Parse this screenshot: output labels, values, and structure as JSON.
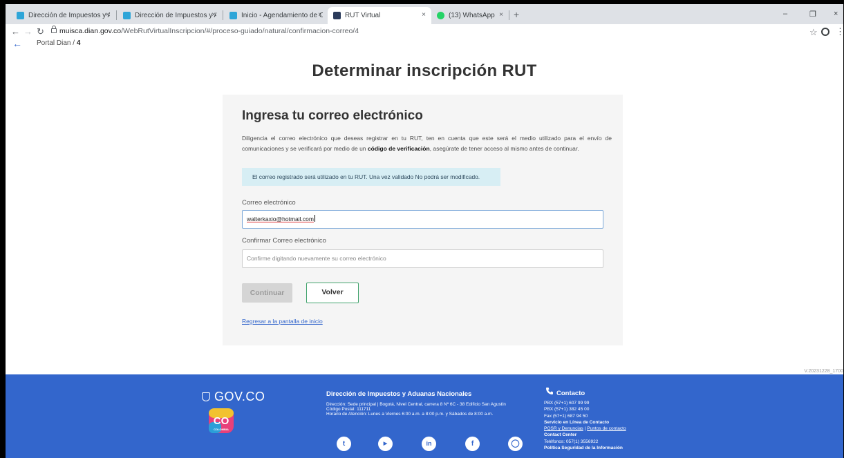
{
  "browser": {
    "tabs": [
      {
        "title": "Dirección de Impuestos y Aduan",
        "favicon_color": "#2ea5d8"
      },
      {
        "title": "Dirección de Impuestos y Aduan",
        "favicon_color": "#2ea5d8"
      },
      {
        "title": "Inicio - Agendamiento de Citas",
        "favicon_color": "#2ea5d8"
      },
      {
        "title": "RUT Virtual",
        "favicon_color": "#2a3a5a",
        "active": true
      },
      {
        "title": "(13) WhatsApp",
        "favicon_color": "#25d366"
      }
    ],
    "tab_close": "×",
    "new_tab": "+",
    "window_controls": {
      "minimize": "–",
      "restore": "❐",
      "close": "×"
    },
    "url_host": "muisca.dian.gov.co",
    "url_path": "/WebRutVirtualInscripcion/#/proceso-guiado/natural/confirmacion-correo/4"
  },
  "page": {
    "breadcrumb_prefix": "Portal Dian / ",
    "breadcrumb_current": "4",
    "title": "Determinar inscripción RUT",
    "card": {
      "heading": "Ingresa tu correo electrónico",
      "desc_part1": "Diligencia el correo electrónico que deseas registrar en tu RUT, ten en cuenta que este será el medio utilizado para el envío de comunicaciones y se verificará por medio de un ",
      "desc_bold": "código de verificación",
      "desc_part2": ", asegúrate de tener acceso al mismo antes de continuar.",
      "info": "El correo registrado será utilizado en tu RUT. Una vez validado No podrá ser modificado.",
      "email_label": "Correo electrónico",
      "email_value": "walterkaxio@hotmail.com",
      "confirm_label": "Confirmar Correo electrónico",
      "confirm_placeholder": "Confirme digitando nuevamente su correo electrónico",
      "continue_label": "Continuar",
      "back_label": "Volver",
      "home_link": "Regresar a la pantalla de inicio"
    },
    "version": "V.20231228_1700"
  },
  "footer": {
    "govco": "GOV.CO",
    "colombia": "CO",
    "colombia_sub": "COLOMBIA",
    "dian_title": "Dirección de Impuestos y Aduanas Nacionales",
    "address": "Dirección: Sede principal | Bogotá, Nivel Central, carrera 8 Nº 6C - 38 Edificio San Agustín",
    "postal": "Código Postal: 111711",
    "hours": "Horario de Atención: Lunes a Viernes 6:00 a.m. a 8:00 p.m. y Sábados de 8:00 a.m.",
    "contact_title": "Contacto",
    "pbx1": "PBX (57+1) 607 99 99",
    "pbx2": "PBX (57+1) 382 45 00",
    "fax": "Fax (57+1) 687 94 50",
    "online": "Servicio en Línea de Contacto",
    "pqsr": "PQSR y Denuncias",
    "sep": " | ",
    "puntos": "Puntos de contacto",
    "center": "Contact Center",
    "tel": "Teléfonos: 057(1) 3556922",
    "policy": "Política Seguridad de la Información",
    "socials": [
      "twitter-icon",
      "youtube-icon",
      "linkedin-icon",
      "facebook-icon",
      "instagram-icon"
    ],
    "brand_color": "#3366cc"
  }
}
